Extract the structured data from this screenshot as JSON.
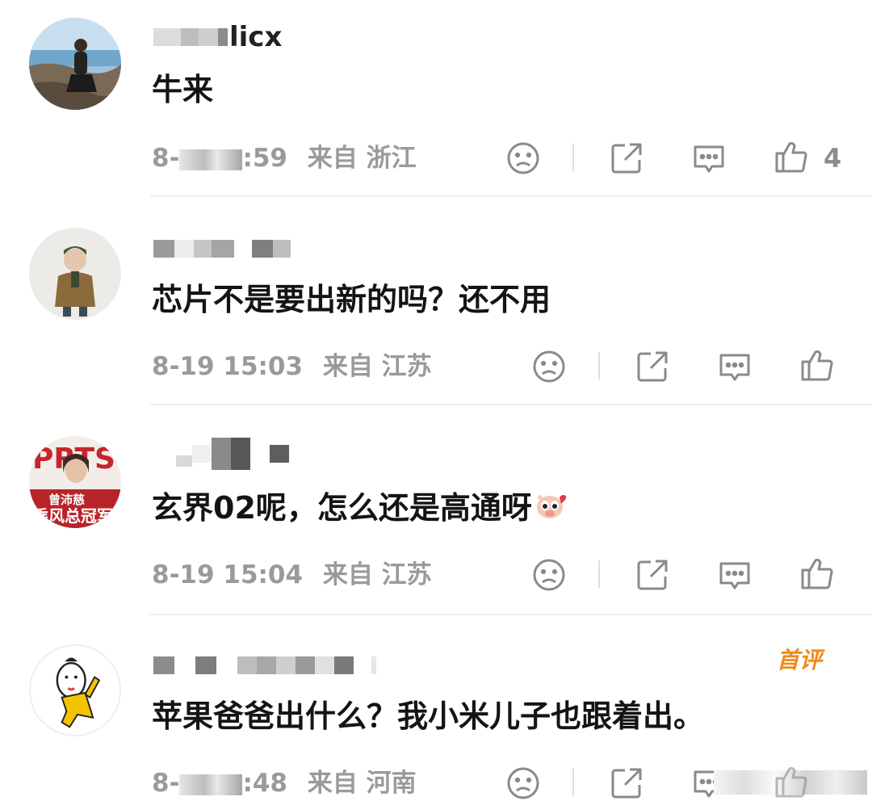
{
  "comments": [
    {
      "username_visible": "licx",
      "text": "牛来",
      "time_visible_prefix": "8-",
      "time_visible_suffix": ":59",
      "location": "来自 浙江",
      "like_count": "4",
      "avatar_icon": "photo-avatar-man-on-rocks"
    },
    {
      "username_visible": "",
      "text": "芯片不是要出新的吗？还不用",
      "time": "8-19 15:03",
      "location": "来自 江苏",
      "avatar_icon": "photo-avatar-child"
    },
    {
      "username_visible": "",
      "text": "玄界02呢，怎么还是高通呀",
      "time": "8-19 15:04",
      "location": "来自 江苏",
      "avatar_icon": "magazine-cover-avatar",
      "inline_emoji": "shy-pig-emoji"
    },
    {
      "username_visible": "",
      "badge": "首评",
      "text": "苹果爸爸出什么？我小米儿子也跟着出。",
      "time_visible_prefix": "8-",
      "time_visible_suffix": ":48",
      "location": "来自 河南",
      "avatar_icon": "cartoon-avatar"
    }
  ],
  "colors": {
    "meta_gray": "#9a9a9a",
    "badge_orange": "#f08a1a",
    "icon_gray": "#8a8a8a"
  }
}
